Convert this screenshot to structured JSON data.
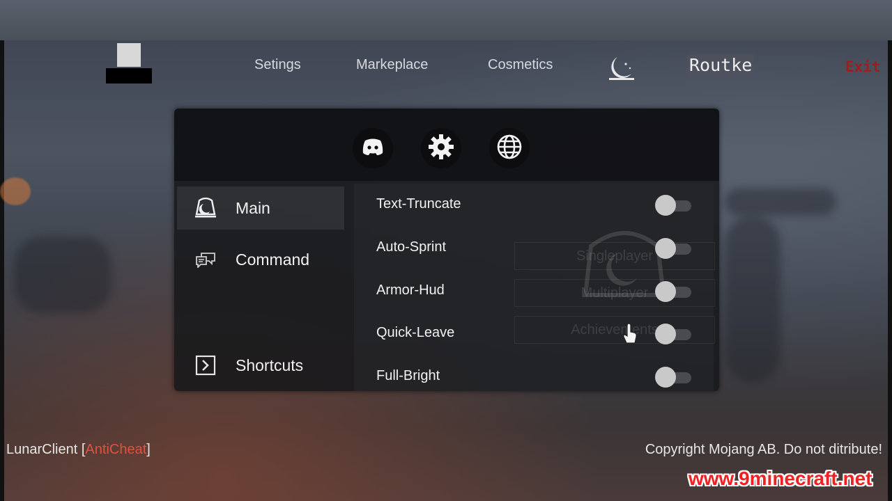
{
  "nav": {
    "items": [
      {
        "label": "Setings"
      },
      {
        "label": "Markeplace"
      },
      {
        "label": "Cosmetics"
      }
    ],
    "theme_icon": "moon-icon",
    "user": "Routke",
    "exit": "Exit"
  },
  "header_buttons": [
    {
      "icon": "discord-icon"
    },
    {
      "icon": "gear-icon"
    },
    {
      "icon": "globe-icon"
    }
  ],
  "sidebar": {
    "items": [
      {
        "label": "Main",
        "icon": "lunar-moon-icon",
        "active": true
      },
      {
        "label": "Command",
        "icon": "chat-icon",
        "active": false
      },
      {
        "label": "Shortcuts",
        "icon": "chevron-right-icon",
        "active": false
      }
    ]
  },
  "modules": [
    {
      "label": "Text-Truncate",
      "enabled": false
    },
    {
      "label": "Auto-Sprint",
      "enabled": false
    },
    {
      "label": "Armor-Hud",
      "enabled": false
    },
    {
      "label": "Quick-Leave",
      "enabled": false
    },
    {
      "label": "Full-Bright",
      "enabled": false
    }
  ],
  "background_menu": [
    "Singleplayer",
    "Multiplayer",
    "Achievements"
  ],
  "footer": {
    "brand": "LunarClient",
    "bracket_open": "[",
    "anticheat": "AntiCheat",
    "bracket_close": "]",
    "copyright": "Copyright Mojang AB. Do not ditribute!",
    "watermark": "www.9minecraft.net"
  },
  "colors": {
    "exit": "#a11c1c",
    "anticheat": "#e0523e",
    "watermark": "#e22222"
  }
}
